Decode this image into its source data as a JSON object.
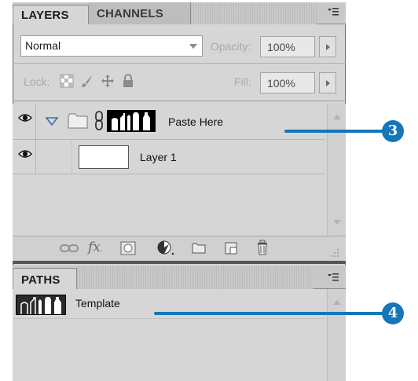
{
  "layers_panel": {
    "tabs": [
      {
        "label": "LAYERS",
        "active": true
      },
      {
        "label": "CHANNELS",
        "active": false
      }
    ],
    "blend_mode": "Normal",
    "opacity_label": "Opacity:",
    "opacity_value": "100%",
    "lock_label": "Lock:",
    "fill_label": "Fill:",
    "fill_value": "100%",
    "layers": [
      {
        "name": "Paste Here",
        "type": "group",
        "visible": true,
        "expanded": true
      },
      {
        "name": "Layer 1",
        "type": "layer",
        "visible": true
      }
    ],
    "footer_icons": [
      "link-layers-icon",
      "fx-icon",
      "layer-mask-icon",
      "adjustment-layer-icon",
      "new-group-icon",
      "new-layer-icon",
      "trash-icon"
    ]
  },
  "paths_panel": {
    "tabs": [
      {
        "label": "PATHS",
        "active": true
      }
    ],
    "paths": [
      {
        "name": "Template"
      }
    ]
  },
  "callouts": [
    {
      "number": "3"
    },
    {
      "number": "4"
    }
  ],
  "colors": {
    "callout": "#1576b9",
    "panel_bg": "#d6d6d6"
  }
}
